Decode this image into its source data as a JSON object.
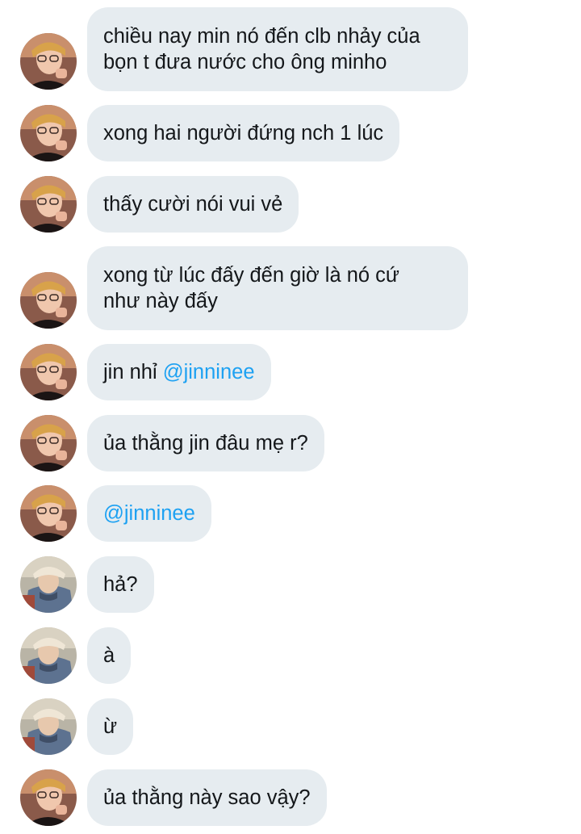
{
  "messages": [
    {
      "sender": "user-a",
      "text": "chiều nay min nó đến clb nhảy của bọn t đưa nước cho ông minho",
      "lines": [
        "chiều nay min nó đến clb nhảy của",
        "bọn t đưa nước cho ông minho"
      ]
    },
    {
      "sender": "user-a",
      "text": "xong hai người đứng nch 1 lúc"
    },
    {
      "sender": "user-a",
      "text": "thấy cười nói vui vẻ"
    },
    {
      "sender": "user-a",
      "text": "xong từ lúc đấy đến giờ là nó cứ như này đấy",
      "lines": [
        "xong từ lúc đấy đến giờ là nó cứ",
        "như này đấy"
      ]
    },
    {
      "sender": "user-a",
      "text": "jin nhỉ ",
      "mention": "@jinninee"
    },
    {
      "sender": "user-a",
      "text": "ủa thằng jin đâu mẹ r?"
    },
    {
      "sender": "user-a",
      "text": "",
      "mention": "@jinninee"
    },
    {
      "sender": "user-b",
      "text": "hả?"
    },
    {
      "sender": "user-b",
      "text": "à"
    },
    {
      "sender": "user-b",
      "text": "ừ"
    },
    {
      "sender": "user-a",
      "text": "ủa thằng này sao vậy?"
    }
  ],
  "colors": {
    "bubble_bg": "#e6ecf0",
    "text": "#14171a",
    "mention": "#1da1f2"
  },
  "icons": {
    "user-a": "avatar-photo-user-a",
    "user-b": "avatar-photo-user-b"
  }
}
